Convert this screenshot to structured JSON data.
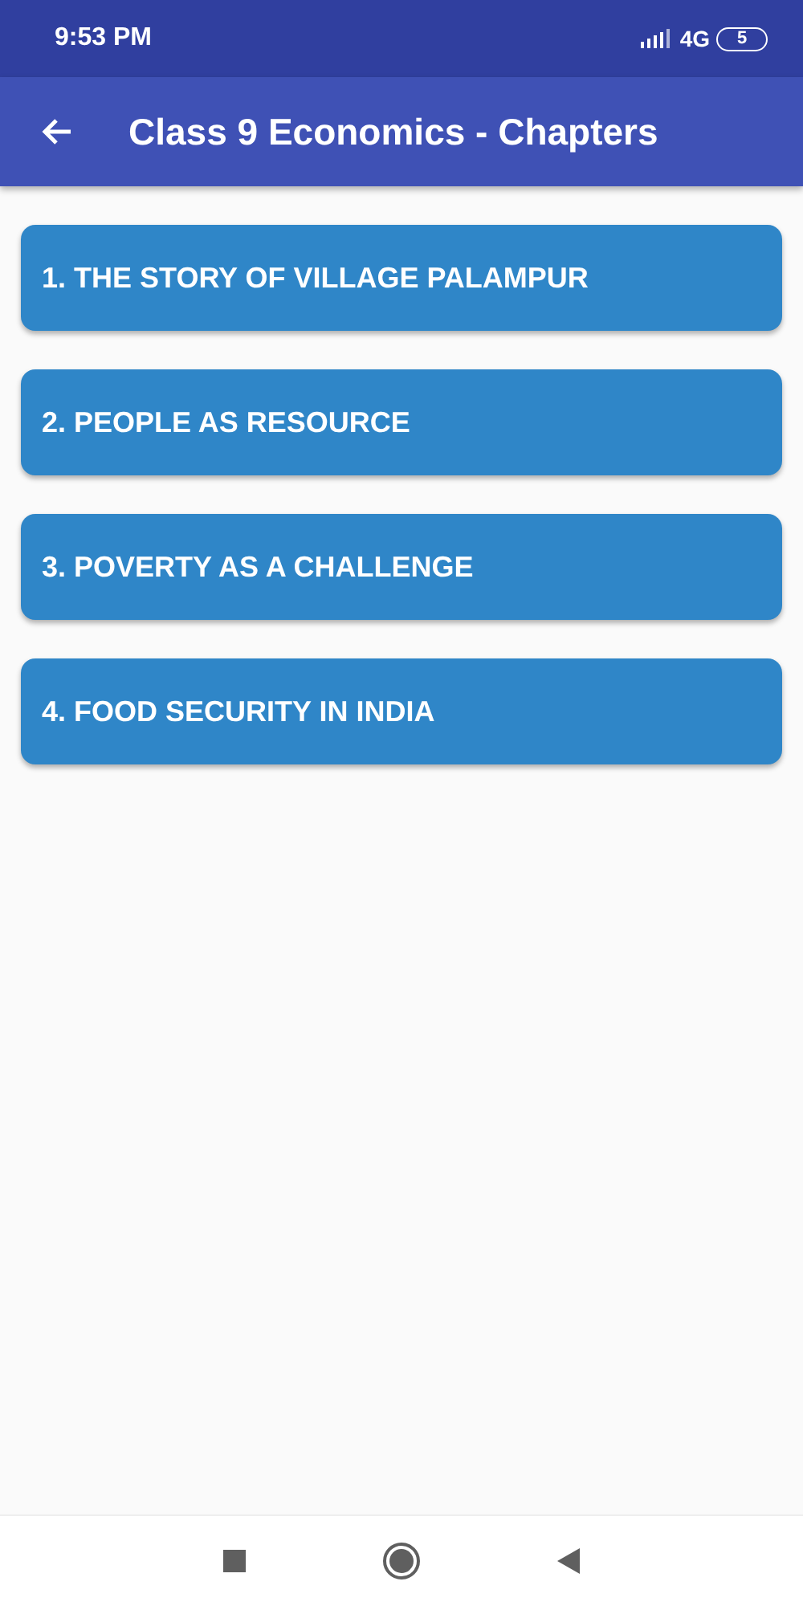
{
  "status_bar": {
    "time": "9:53 PM",
    "network": "4G",
    "battery": "5"
  },
  "app_bar": {
    "title": "Class 9 Economics - Chapters"
  },
  "chapters": [
    {
      "label": "1. THE STORY OF VILLAGE PALAMPUR"
    },
    {
      "label": "2. PEOPLE AS RESOURCE"
    },
    {
      "label": "3. POVERTY AS A CHALLENGE"
    },
    {
      "label": "4. FOOD SECURITY IN INDIA"
    }
  ]
}
